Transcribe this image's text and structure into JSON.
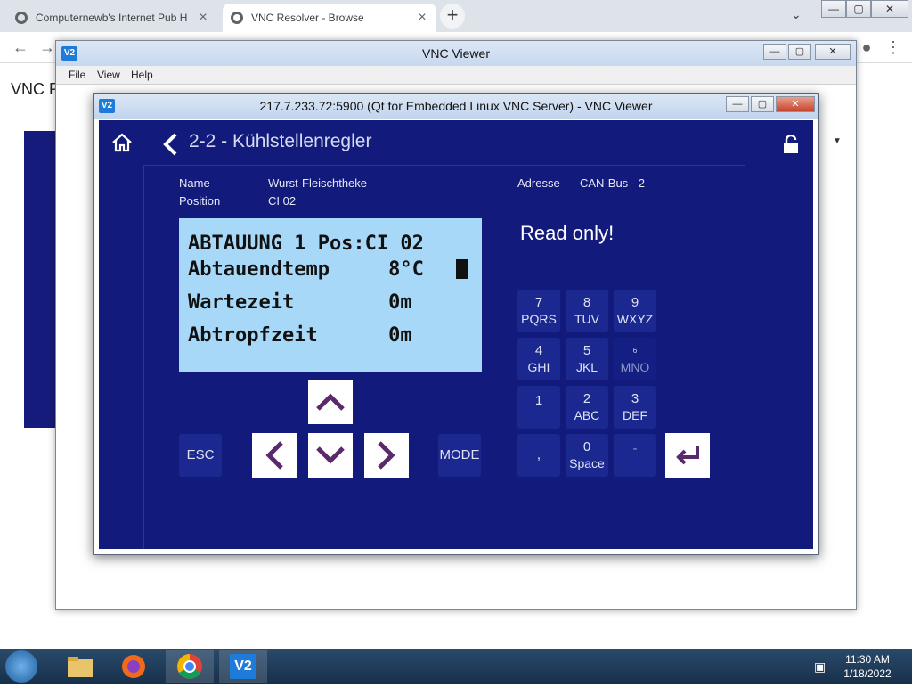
{
  "browser": {
    "tabs": [
      {
        "title": "Computernewb's Internet Pub H",
        "close": "×"
      },
      {
        "title": "VNC Resolver - Browse",
        "close": "×"
      }
    ],
    "new_tab": "+",
    "page_heading": "VNC R",
    "window_controls": {
      "min": "—",
      "max": "▢",
      "close": "✕"
    }
  },
  "outer_viewer": {
    "title": "VNC Viewer",
    "menu": [
      "File",
      "View",
      "Help"
    ],
    "logo": "V2"
  },
  "inner_viewer": {
    "title": "217.7.233.72:5900 (Qt for Embedded Linux VNC Server) - VNC Viewer",
    "logo": "V2"
  },
  "remote": {
    "title": "2-2 - Kühlstellenregler",
    "info": {
      "name_label": "Name",
      "name_value": "Wurst-Fleischtheke",
      "position_label": "Position",
      "position_value": "CI 02",
      "address_label": "Adresse",
      "address_value": "CAN-Bus - 2"
    },
    "lcd_lines": [
      "ABTAUUNG 1 Pos:CI 02",
      "Abtauendtemp     8°C",
      "Wartezeit        0m",
      "Abtropfzeit      0m"
    ],
    "readonly_text": "Read only!",
    "esc_label": "ESC",
    "mode_label": "MODE",
    "keypad": [
      {
        "main": "7",
        "sub": "PQRS"
      },
      {
        "main": "8",
        "sub": "TUV"
      },
      {
        "main": "9",
        "sub": "WXYZ"
      },
      {
        "main": "4",
        "sub": "GHI"
      },
      {
        "main": "5",
        "sub": "JKL"
      },
      {
        "main": "6",
        "sub": "MNO"
      },
      {
        "main": "1",
        "sub": ""
      },
      {
        "main": "2",
        "sub": "ABC"
      },
      {
        "main": "3",
        "sub": "DEF"
      },
      {
        "main": ",",
        "sub": ""
      },
      {
        "main": "0",
        "sub": "Space"
      },
      {
        "main": "-",
        "sub": ""
      }
    ]
  },
  "taskbar": {
    "time": "11:30 AM",
    "date": "1/18/2022"
  },
  "colors": {
    "remote_bg": "#121b7c",
    "lcd_bg": "#a7d8f8",
    "key_bg": "#1b2890",
    "arrow_color": "#5a2a6a"
  }
}
